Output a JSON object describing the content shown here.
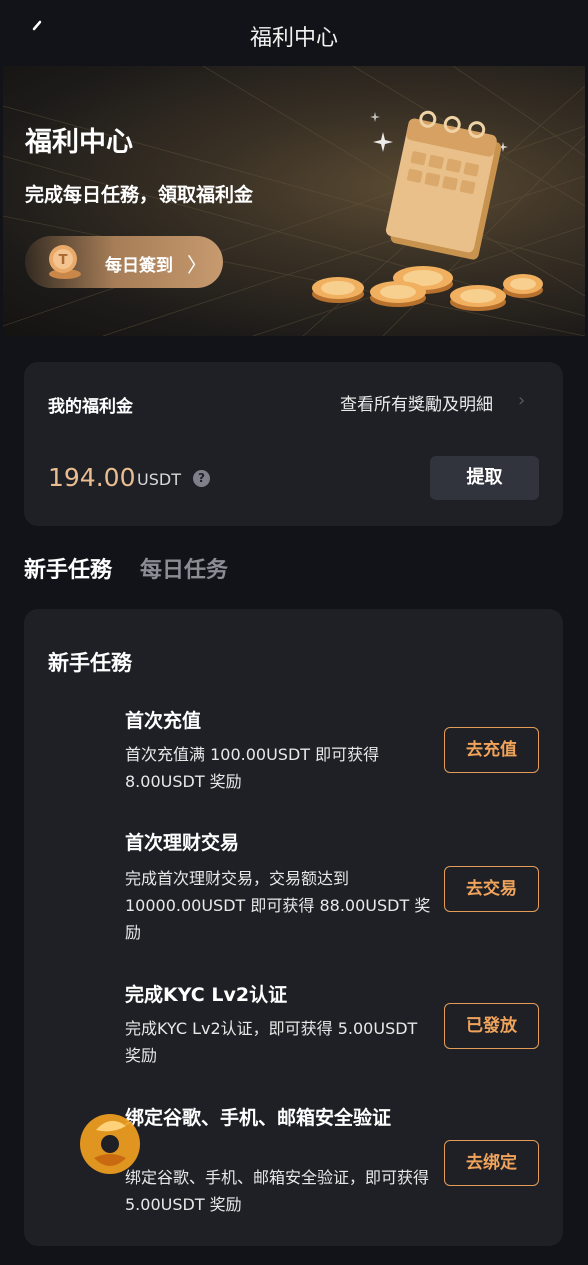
{
  "header": {
    "title": "福利中心"
  },
  "banner": {
    "title": "福利中心",
    "subtitle": "完成每日任務，領取福利金",
    "checkin_label": "每日簽到",
    "checkin_arrow": "〉"
  },
  "wallet": {
    "label": "我的福利金",
    "view_all": "查看所有獎勵及明細",
    "balance": "194.00",
    "unit": "USDT",
    "help": "?",
    "withdraw": "提取"
  },
  "tabs": [
    {
      "label": "新手任務",
      "active": true
    },
    {
      "label": "每日任务",
      "active": false
    }
  ],
  "tasks_section": {
    "title": "新手任務",
    "tasks": [
      {
        "title": "首次充值",
        "desc": "首次充值满 100.00USDT 即可获得 8.00USDT 奖励",
        "action": "去充值"
      },
      {
        "title": "首次理财交易",
        "desc": "完成首次理财交易，交易额达到 10000.00USDT 即可获得 88.00USDT 奖励",
        "action": "去交易"
      },
      {
        "title": "完成KYC Lv2认证",
        "desc": "完成KYC Lv2认证，即可获得 5.00USDT 奖励",
        "action": "已發放"
      },
      {
        "title": "绑定谷歌、手机、邮箱安全验证",
        "desc": "绑定谷歌、手机、邮箱安全验证，即可获得 5.00USDT 奖励",
        "action": "去绑定"
      }
    ]
  },
  "colors": {
    "accent": "#e39c55",
    "balance": "#e9bd8f",
    "background": "#121318",
    "card": "#1e2026"
  }
}
